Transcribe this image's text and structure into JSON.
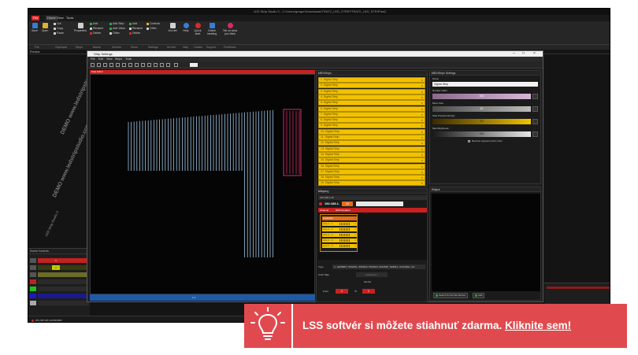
{
  "app": {
    "title": "LED Strip Studio 3 - C:\\Users\\gregor\\Downloads\\TRAT2_LED_STRIP\\TRAT2_LED_STRIP.lss2"
  },
  "menu": {
    "items": [
      "File",
      "Home",
      "View",
      "Tools"
    ]
  },
  "ribbon": {
    "buttons": {
      "save": "Save",
      "open": "Open",
      "cut": "Cut",
      "copy": "Copy",
      "paste": "Paste",
      "properties": "Properties",
      "add": "Add",
      "rename": "Rename",
      "delete": "Delete",
      "add_strip": "Add Strip",
      "add_video": "Add Video",
      "other": "Other",
      "add2": "Add",
      "rename2": "Rename",
      "delete2": "Delete",
      "controls": "Controls",
      "other2": "Other",
      "artnet": "Art-Net",
      "help": "Help",
      "quick_start": "Quick start",
      "online_meeting": "Online meeting",
      "tell_us": "Tell us what you think"
    },
    "groups": [
      "File",
      "Clipboard",
      "Strips",
      "Banks",
      "Scenes",
      "Show",
      "Settings",
      "Art-Net",
      "Help",
      "Guides",
      "Support",
      "Feedback"
    ]
  },
  "document": {
    "panel_label": "Preview",
    "tab": "Scene 1"
  },
  "watermark": {
    "text_large": "DEMO www.ledstripstudio.com",
    "text_small": "LED Strip Studio 3"
  },
  "scene_controls": {
    "title": "Scene Controls",
    "rows": [
      {
        "num": "1",
        "color": "#c42020"
      },
      {
        "num": "2",
        "color": "#c8c800"
      },
      {
        "num": "3",
        "color": "#6b6b2a"
      },
      {
        "num": "4",
        "color": "#2222cc"
      },
      {
        "num": "5",
        "color": "#20c020"
      },
      {
        "num": "6",
        "color": "#1a1ac8"
      },
      {
        "num": "7",
        "color": "#aaaaaa"
      }
    ]
  },
  "status": {
    "text": "Art-net not connected"
  },
  "strip_settings": {
    "title": "Strip Settings",
    "menu": [
      "File",
      "Edit",
      "View",
      "Strips",
      "Tools"
    ],
    "canvas_label": "Strip Editor",
    "bottom_label": "1:1"
  },
  "led_strips": {
    "title": "LED Strips",
    "items": [
      "1. Digital Strip",
      "2. Digital Strip",
      "3. Digital Strip",
      "4. Digital Strip",
      "5. Digital Strip",
      "6. Digital Strip",
      "7. Digital Strip",
      "8. Digital Strip",
      "9. Digital Strip",
      "10. Digital Strip",
      "11. Digital Strip",
      "12. Digital Strip",
      "13. Digital Strip",
      "14. Digital Strip",
      "15. Digital Strip",
      "16. Digital Strip",
      "17. Digital Strip",
      "18. Digital Strip",
      "19. Digital Strip"
    ]
  },
  "mapping": {
    "title": "Mapping",
    "ip_field": "192.168.1.15",
    "selected_ip": "192.168.1.",
    "selected_num": "15",
    "tabs": [
      "Channel",
      "DMX Enabled"
    ],
    "controller": "Controller",
    "rows": [
      "strip 1 - 1",
      "strip 2 - 2",
      "strip 3 - 3",
      "strip 4 - 4",
      "strip 5 - 5"
    ],
    "type_label": "Type",
    "type_value": "2 - EMSBPY, WS2811, WS2812, WS2813, WS2815, SK6812, UCS1903, UC...",
    "color_map_label": "Color Map",
    "advanced_label": "Advanced >",
    "checkbox_label": "Set list",
    "from_label": "From",
    "from_value": "1",
    "to_label": "To",
    "to_value": "1"
  },
  "settings": {
    "title": "LED Strips Settings",
    "name_label": "Name",
    "name_value": "Digital Strip",
    "leds_label": "Number LEDs",
    "leds_value": "300",
    "size_label": "Move Size",
    "size_value": "10",
    "density_label": "Strip Preview Density",
    "density_value": "10",
    "brightness_label": "Max Brightness",
    "brightness_value": "100",
    "checkbox_label": "Reverse segment point order"
  },
  "output": {
    "title": "Output",
    "btn1": "Search for Art-Net Device",
    "btn2": "Add"
  },
  "banner": {
    "message": "LSS softvér si môžete stiahnuť zdarma.",
    "link": "Kliknite sem!"
  }
}
